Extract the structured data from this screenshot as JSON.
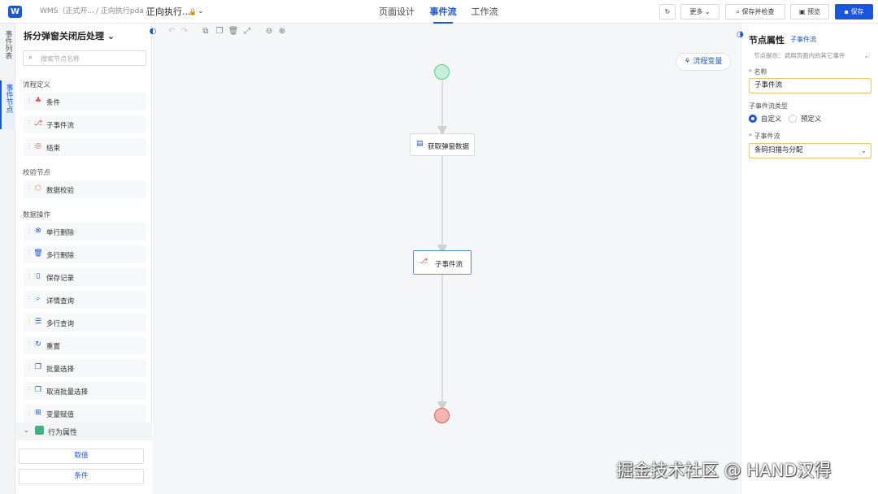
{
  "header": {
    "logo": "W",
    "breadcrumb": [
      "WMS（正式开...",
      "/ 正向执行pda /",
      "正向执行..."
    ],
    "tabs": [
      {
        "label": "页面设计",
        "active": false
      },
      {
        "label": "事件流",
        "active": true
      },
      {
        "label": "工作流",
        "active": false
      }
    ],
    "more_label": "更多",
    "save_check_label": "保存并检查",
    "preview_label": "预览",
    "save_label": "保存",
    "accent_color": "#1a56db"
  },
  "side_tabs": [
    "事件列表",
    "事件节点"
  ],
  "left_panel": {
    "title": "拆分弹窗关闭后处理",
    "search_placeholder": "搜索节点名称",
    "sections": [
      {
        "label": "流程定义",
        "items": [
          {
            "label": "条件",
            "icon": "condition-icon"
          },
          {
            "label": "子事件流",
            "icon": "subflow-icon"
          },
          {
            "label": "结束",
            "icon": "end-icon"
          }
        ]
      },
      {
        "label": "校验节点",
        "items": [
          {
            "label": "数据校验",
            "icon": "validate-icon"
          }
        ]
      },
      {
        "label": "数据操作",
        "items": [
          {
            "label": "单行删除",
            "icon": "delete-row-icon"
          },
          {
            "label": "多行删除",
            "icon": "trash-icon"
          },
          {
            "label": "保存记录",
            "icon": "save-record-icon"
          },
          {
            "label": "详情查询",
            "icon": "detail-query-icon"
          },
          {
            "label": "多行查询",
            "icon": "list-query-icon"
          },
          {
            "label": "重置",
            "icon": "reset-icon"
          },
          {
            "label": "批量选择",
            "icon": "batch-select-icon"
          },
          {
            "label": "取消批量选择",
            "icon": "cancel-batch-icon"
          },
          {
            "label": "变量赋值",
            "icon": "variable-icon"
          }
        ]
      }
    ],
    "behavior_label": "行为属性",
    "value_button": "取值",
    "condition_button": "条件"
  },
  "canvas": {
    "flow_variable_label": "流程变量",
    "nodes": [
      {
        "label": "获取弹窗数据",
        "icon": "data-fetch-icon"
      },
      {
        "label": "子事件流",
        "icon": "subflow-icon"
      }
    ]
  },
  "right_panel": {
    "title": "节点属性",
    "node_type": "子事件流",
    "hint": "节点提示：调用页面内的其它事件",
    "name_label": "名称",
    "name_value": "子事件流",
    "subflow_type_label": "子事件流类型",
    "radio_custom": "自定义",
    "radio_predefined": "预定义",
    "subflow_label": "子事件流",
    "subflow_value": "条码扫描与分配"
  },
  "watermark": "掘金技术社区 @ HAND汉得"
}
